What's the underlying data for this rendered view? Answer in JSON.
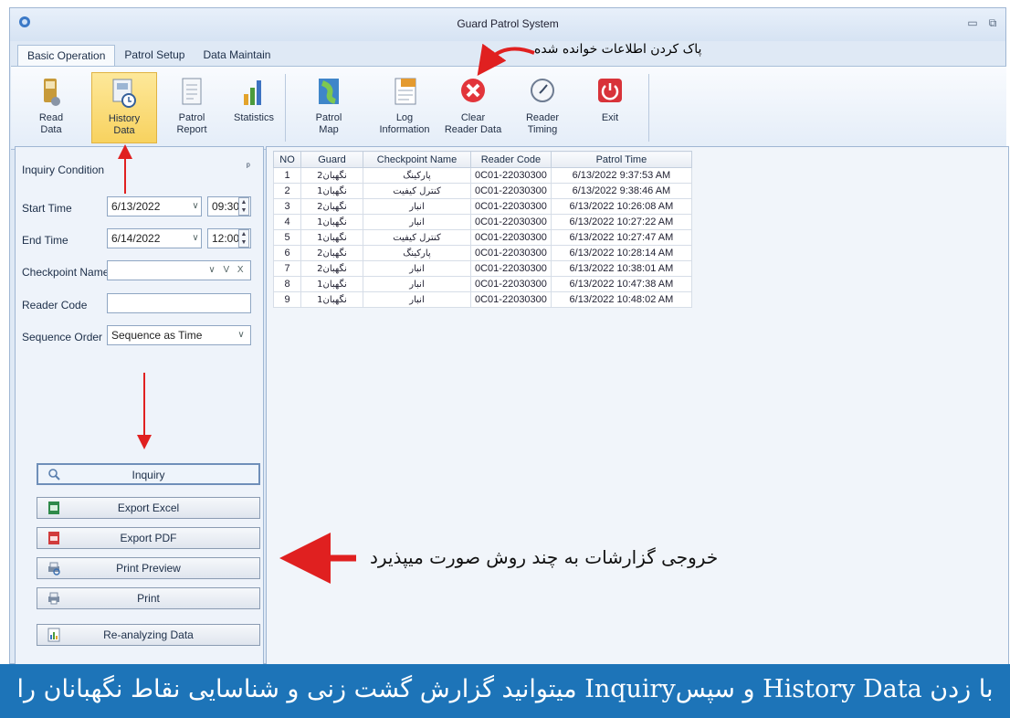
{
  "window": {
    "title": "Guard Patrol System"
  },
  "tabs": [
    {
      "label": "Basic Operation",
      "active": true
    },
    {
      "label": "Patrol Setup",
      "active": false
    },
    {
      "label": "Data Maintain",
      "active": false
    }
  ],
  "ribbon": {
    "read_data": "Read\nData",
    "history_data": "History\nData",
    "patrol_report": "Patrol\nReport",
    "statistics": "Statistics",
    "patrol_map": "Patrol\nMap",
    "log_information": "Log\nInformation",
    "clear_reader_data": "Clear\nReader Data",
    "reader_timing": "Reader\nTiming",
    "exit": "Exit"
  },
  "annotations": {
    "clear_note": "پاک کردن اطلاعات خوانده شده",
    "export_note": "خروجی گزارشات به چند روش صورت میپذیرد",
    "banner": "با زدن History Data و سپسInquiry میتوانید گزارش گشت زنی و شناسایی نقاط نگهبانان را مشاهده کنید"
  },
  "inquiry": {
    "title": "Inquiry Condition",
    "pin": "ᵖ",
    "start_time_label": "Start Time",
    "start_date": "6/13/2022",
    "start_clock": "09:30",
    "end_time_label": "End Time",
    "end_date": "6/14/2022",
    "end_clock": "12:00",
    "checkpoint_label": "Checkpoint Name",
    "checkpoint_value": "",
    "reader_code_label": "Reader Code",
    "reader_code_value": "",
    "sequence_label": "Sequence Order",
    "sequence_value": "Sequence as Time",
    "buttons": {
      "inquiry": "Inquiry",
      "export_excel": "Export Excel",
      "export_pdf": "Export PDF",
      "print_preview": "Print Preview",
      "print": "Print",
      "reanalyzing": "Re-analyzing Data"
    }
  },
  "grid": {
    "headers": [
      "NO",
      "Guard",
      "Checkpoint Name",
      "Reader Code",
      "Patrol Time"
    ],
    "rows": [
      [
        "1",
        "نگهبان2",
        "پارکینگ",
        "0C01-22030300",
        "6/13/2022 9:37:53 AM"
      ],
      [
        "2",
        "نگهبان1",
        "کنترل کیفیت",
        "0C01-22030300",
        "6/13/2022 9:38:46 AM"
      ],
      [
        "3",
        "نگهبان2",
        "انبار",
        "0C01-22030300",
        "6/13/2022 10:26:08 AM"
      ],
      [
        "4",
        "نگهبان1",
        "انبار",
        "0C01-22030300",
        "6/13/2022 10:27:22 AM"
      ],
      [
        "5",
        "نگهبان1",
        "کنترل کیفیت",
        "0C01-22030300",
        "6/13/2022 10:27:47 AM"
      ],
      [
        "6",
        "نگهبان2",
        "پارکینگ",
        "0C01-22030300",
        "6/13/2022 10:28:14 AM"
      ],
      [
        "7",
        "نگهبان2",
        "انبار",
        "0C01-22030300",
        "6/13/2022 10:38:01 AM"
      ],
      [
        "8",
        "نگهبان1",
        "انبار",
        "0C01-22030300",
        "6/13/2022 10:47:38 AM"
      ],
      [
        "9",
        "نگهبان1",
        "انبار",
        "0C01-22030300",
        "6/13/2022 10:48:02 AM"
      ]
    ]
  },
  "colors": {
    "arrow": "#e02020",
    "banner": "#1d74b8",
    "selected": "#f8d25f"
  }
}
